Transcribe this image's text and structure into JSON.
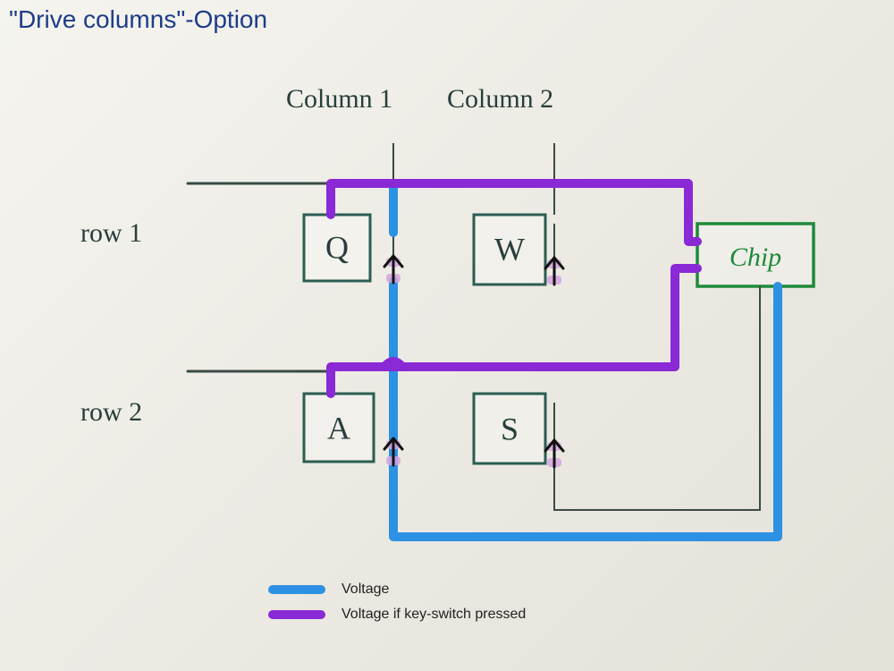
{
  "title": "\"Drive columns\"-Option",
  "col_labels": {
    "c1": "Column 1",
    "c2": "Column 2"
  },
  "row_labels": {
    "r1": "row 1",
    "r2": "row 2"
  },
  "keys": {
    "q": "Q",
    "w": "W",
    "a": "A",
    "s": "S"
  },
  "chip_label": "Chip",
  "legend": {
    "voltage": "Voltage",
    "pressed": "Voltage if key-switch pressed"
  },
  "colors": {
    "voltage": "#2d91e3",
    "pressed": "#8a29d6",
    "pencil": "#3a4a46",
    "key_outline": "#2a5d52",
    "chip_outline": "#1e8a3a",
    "title": "#1d3d87"
  },
  "diagram": {
    "type": "keyboard-matrix-schematic",
    "rows": 2,
    "columns": 2,
    "drive_direction": "columns",
    "scan_lines": "rows",
    "keys_matrix": [
      {
        "row": 1,
        "col": 1,
        "label": "Q"
      },
      {
        "row": 1,
        "col": 2,
        "label": "W"
      },
      {
        "row": 2,
        "col": 1,
        "label": "A"
      },
      {
        "row": 2,
        "col": 2,
        "label": "S"
      }
    ],
    "diodes_per_key": true,
    "controller": "Chip",
    "highlights": [
      {
        "color_role": "voltage",
        "meaning": "Voltage driven from chip into column 1 and column 2"
      },
      {
        "color_role": "pressed",
        "meaning": "Voltage appearing on row 1 and row 2 (returning to chip) when key-switch pressed"
      }
    ]
  }
}
